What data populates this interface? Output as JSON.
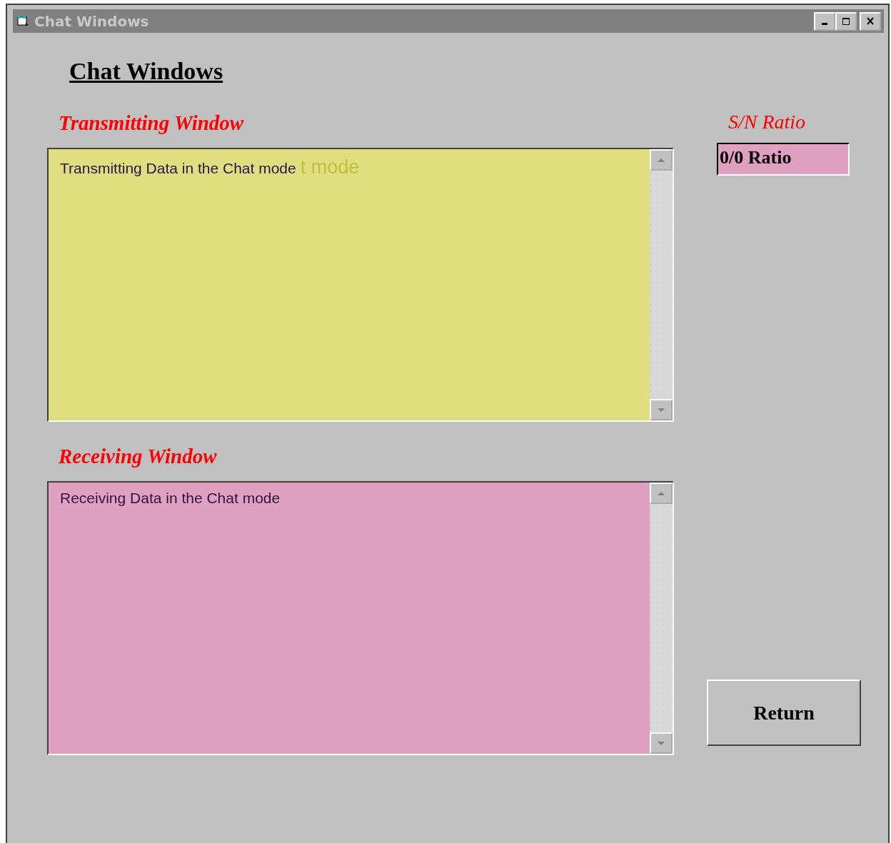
{
  "window": {
    "title": "Chat Windows"
  },
  "heading": "Chat Windows",
  "panes": [
    {
      "label": "Transmitting Window",
      "text": "Transmitting Data in the Chat mode",
      "ghost_text": "t mode",
      "color": "#e0df80"
    },
    {
      "label": "Receiving Window",
      "text": "Receiving Data in the Chat mode",
      "color": "#e0a0c0"
    }
  ],
  "ratio": {
    "label": "S/N Ratio",
    "value": "0/0 Ratio"
  },
  "buttons": [
    "Return"
  ]
}
